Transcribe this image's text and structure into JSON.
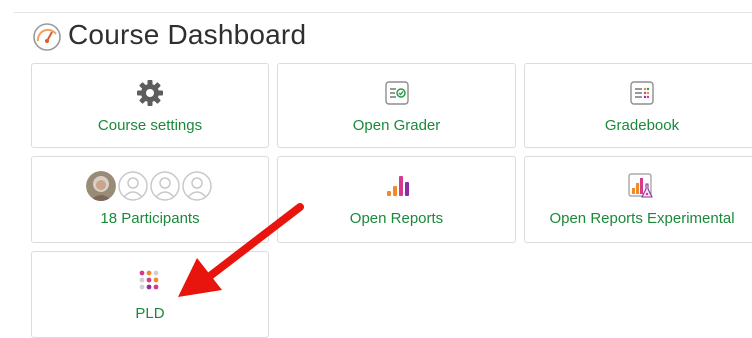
{
  "header": {
    "title": "Course Dashboard",
    "icon": "dashboard-gauge-icon"
  },
  "tiles": [
    {
      "label": "Course settings",
      "icon": "gear-icon"
    },
    {
      "label": "Open Grader",
      "icon": "grader-checklist-icon"
    },
    {
      "label": "Gradebook",
      "icon": "gradebook-list-icon"
    },
    {
      "label": "18 Participants",
      "icon": "participant-avatars-icon"
    },
    {
      "label": "Open Reports",
      "icon": "bar-chart-icon"
    },
    {
      "label": "Open Reports Experimental",
      "icon": "experimental-chart-icon"
    },
    {
      "label": "PLD",
      "icon": "dot-grid-icon"
    }
  ],
  "colors": {
    "accent_green": "#1a8a3a",
    "annotation_red": "#e8150f",
    "report_orange": "#f28a2a",
    "report_pink": "#d63a8c",
    "report_purple": "#8b2fa0"
  }
}
